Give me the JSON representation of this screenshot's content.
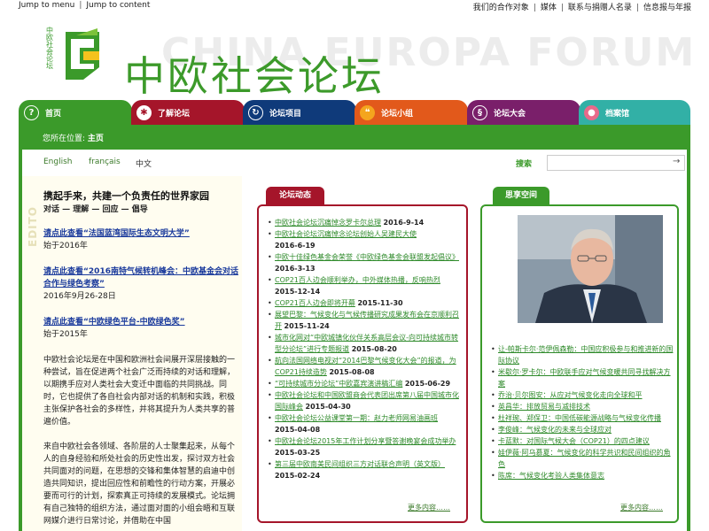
{
  "top_links": {
    "jump_menu": "Jump to menu",
    "jump_content": "Jump to content",
    "right": [
      "我们的合作对象",
      "媒体",
      "联系与捐赠人名录",
      "信息报与年报"
    ]
  },
  "header": {
    "vertical_text": "中欧社会论坛",
    "watermark": "CHINA EUROPA FORUM",
    "title": "中欧社会论坛"
  },
  "nav": {
    "tabs": [
      {
        "label": "首页",
        "icon": "?"
      },
      {
        "label": "了解论坛",
        "icon": "✱"
      },
      {
        "label": "论坛项目",
        "icon": "↻"
      },
      {
        "label": "论坛小组",
        "icon": "❝"
      },
      {
        "label": "论坛大会",
        "icon": "§"
      },
      {
        "label": "档案馆",
        "icon": "●"
      }
    ]
  },
  "breadcrumb": {
    "prefix": "您所在位置:",
    "current": "主页"
  },
  "languages": {
    "en": "English",
    "fr": "français",
    "zh": "中文"
  },
  "search": {
    "label": "搜索",
    "placeholder": "",
    "button": "→"
  },
  "edito": {
    "tag": "EDITO",
    "title": "携起手来，共建一个负责任的世界家园",
    "subtitle": "对话 — 理解 — 回应 — 倡导",
    "links": [
      {
        "text": "请点此查看“法国蓝湾国际生态文明大学”",
        "date": "始于2016年"
      },
      {
        "text": "请点此查看“2016南特气候转机峰会：中欧基金会对话合作与绿色考察”",
        "date": "2016年9月26-28日"
      },
      {
        "text": "请点此查看“中欧绿色平台-中欧绿色奖”",
        "date": "始于2015年"
      }
    ],
    "para1": "中欧社会论坛是在中国和欧洲社会间展开深层接触的一种尝试，旨在促进两个社会广泛而持续的对话和理解，以期携手应对人类社会大变迁中面临的共同挑战。同时，它也提供了各自社会内部对话的机制和实践，积极主张保护各社会的多样性，并将其提升为人类共享的普遍价值。",
    "para2": "来自中欧社会各领域、各阶层的人士聚集起来，从每个人的自身经验和所处社会的历史性出发，探讨双方社会共同面对的问题，在思想的交锋和集体智慧的启迪中创造共同知识，提出回应性和前瞻性的行动方案，开展必要而可行的计划，探索真正可持续的发展模式。论坛拥有自己独特的组织方法，通过面对面的小组会晤和互联网媒介进行日常讨论，并借助在中国"
  },
  "news": {
    "tag": "论坛动态",
    "items": [
      {
        "text": "中欧社会论坛沉痛悼念罗卡尔总理",
        "date": "2016-9-14"
      },
      {
        "text": "中欧社会论坛沉痛悼念论坛创始人吴建民大使",
        "date": "2016-6-19"
      },
      {
        "text": "中欧十佳绿色基金会荣誉《中欧绿色基金会联盟发起倡议》",
        "date": "2016-3-13"
      },
      {
        "text": "COP21百人边会顺利举办，中外媒体热播，反响热烈",
        "date": "2015-12-14"
      },
      {
        "text": "COP21百人边会即将开幕",
        "date": "2015-11-30"
      },
      {
        "text": "展望巴黎：气候变化与气候传播研究成果发布会在京顺利召开",
        "date": "2015-11-24"
      },
      {
        "text": "城市化网对“中欧城镇化伙伴关系高层会议-向可持续城市转型分论坛”进行专题报道",
        "date": "2015-08-20"
      },
      {
        "text": "航向法国网络电视对“2014巴黎气候变化大会”的报道，为COP21持续造势",
        "date": "2015-08-08"
      },
      {
        "text": "“可持续城市分论坛”中欧嘉宾演讲稿汇编",
        "date": "2015-06-29"
      },
      {
        "text": "中欧社会论坛和中国欧盟商会代表团出席第八届中国城市化国际峰会",
        "date": "2015-04-30"
      },
      {
        "text": "中欧社会论坛公益课堂第一期：赵力老师网易油画班",
        "date": "2015-04-08"
      },
      {
        "text": "中欧社会论坛2015年工作计划分享暨答谢晚宴会成功举办",
        "date": "2015-03-25"
      },
      {
        "text": "第三届中欧南美民间组织三方对话联合声明（英文版）",
        "date": "2015-02-24"
      }
    ],
    "more": "更多内容……"
  },
  "thinkers": {
    "tag": "思享空间",
    "photo_alt": "portrait",
    "items": [
      "让-帕斯卡尔·范伊佩森勒：中国应积极参与和推进新的国际协议",
      "米歇尔·罗卡尔：中欧联手应对气候变暖共同寻找解决方案",
      "乔治·贝尔图安：从应对气候变化走向全球和平",
      "英昌华：排放贸易与减排技术",
      "杜祥琬、郑保卫：中国低碳能源战略与气候变化传播",
      "李俊峰：气候变化的未来与全球应对",
      "卡蓝默：对国际气候大会（COP21）的四点建议",
      "娃伊薇·阿乌慕夏：气候变化的科学共识和民间组织的角色",
      "陈席：气候变化考验人类集体意志"
    ],
    "more": "更多内容……"
  },
  "colors": {
    "green": "#3b9a2a",
    "red": "#a5152a",
    "navy": "#0f3a7a",
    "orange": "#e2591b",
    "purple": "#7a1f6a",
    "teal": "#32b0a6"
  }
}
